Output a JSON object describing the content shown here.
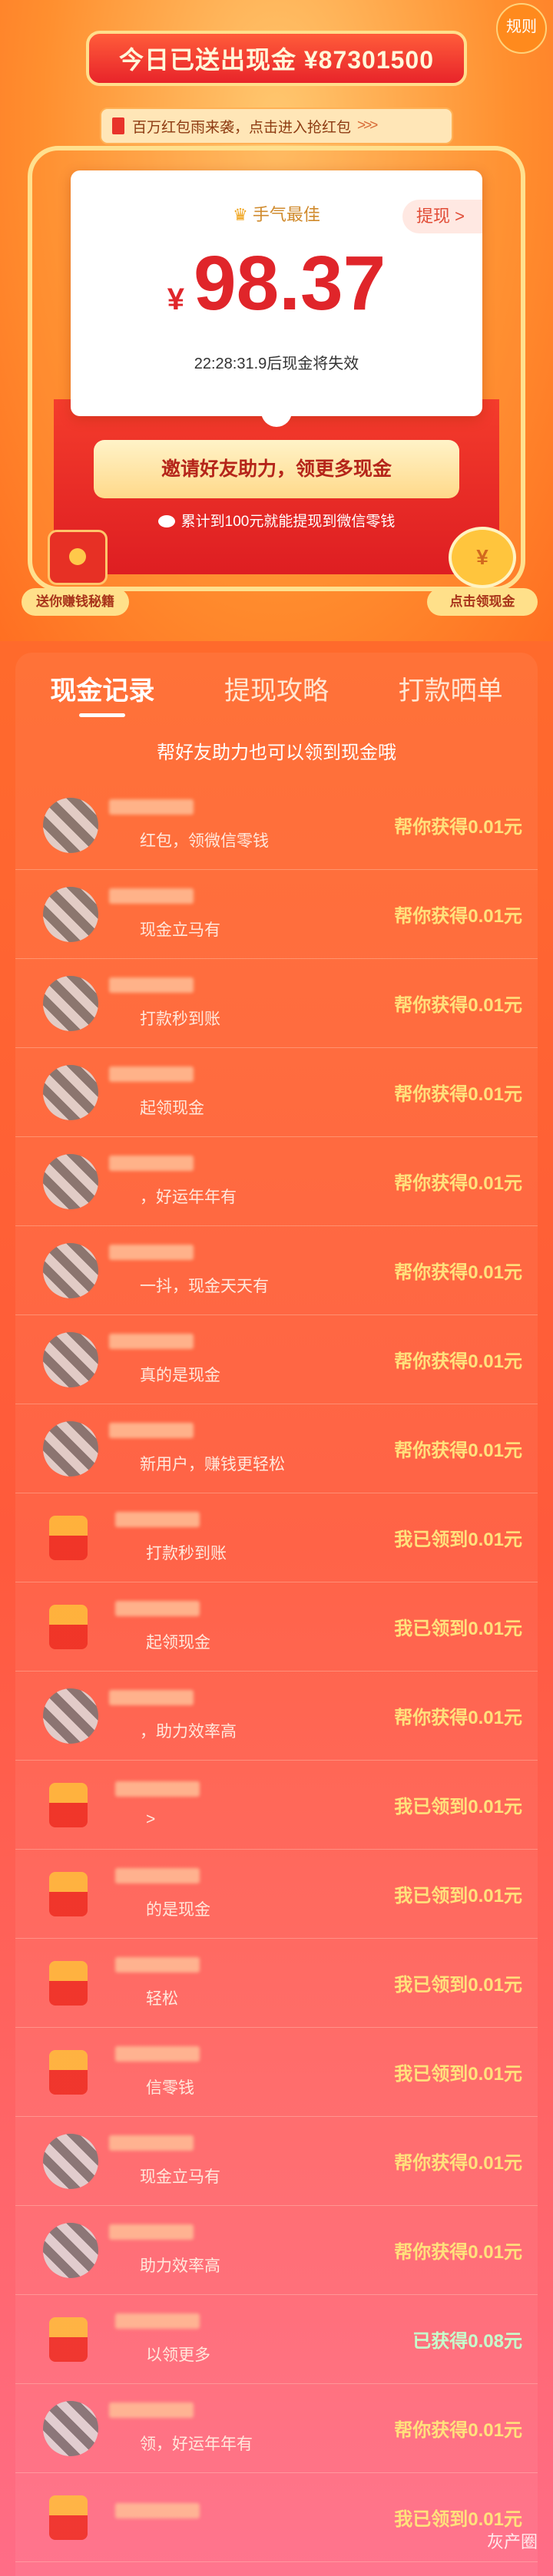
{
  "header": {
    "rules_label": "规则",
    "banner_text": "今日已送出现金 ¥87301500",
    "notice_text": "百万红包雨来袭，点击进入抢红包",
    "notice_arrows": ">>>"
  },
  "card": {
    "best_label": "手气最佳",
    "withdraw_label": "提现 >",
    "currency": "¥",
    "amount": "98.37",
    "expire_text": "22:28:31.9后现金将失效"
  },
  "actions": {
    "invite_label": "邀请好友助力，领更多现金",
    "hint_text": "累计到100元就能提现到微信零钱",
    "secret_label": "送你赚钱秘籍",
    "claim_label": "点击领现金",
    "clock_symbol": "¥"
  },
  "tabs": [
    {
      "label": "现金记录"
    },
    {
      "label": "提现攻略"
    },
    {
      "label": "打款晒单"
    }
  ],
  "subtitle": "帮好友助力也可以领到现金哦",
  "records": [
    {
      "msg": "红包，领微信零钱",
      "result": "帮你获得0.01元"
    },
    {
      "msg": "现金立马有",
      "result": "帮你获得0.01元"
    },
    {
      "msg": "打款秒到账",
      "result": "帮你获得0.01元"
    },
    {
      "msg": "起领现金",
      "result": "帮你获得0.01元"
    },
    {
      "msg": "，好运年年有",
      "result": "帮你获得0.01元"
    },
    {
      "msg": "一抖，现金天天有",
      "result": "帮你获得0.01元"
    },
    {
      "msg": "真的是现金",
      "result": "帮你获得0.01元"
    },
    {
      "msg": "新用户，赚钱更轻松",
      "result": "帮你获得0.01元"
    },
    {
      "msg": "打款秒到账",
      "result": "我已领到0.01元"
    },
    {
      "msg": "起领现金",
      "result": "我已领到0.01元"
    },
    {
      "msg": "，助力效率高",
      "result": "帮你获得0.01元"
    },
    {
      "msg": ">",
      "result": "我已领到0.01元"
    },
    {
      "msg": "的是现金",
      "result": "我已领到0.01元"
    },
    {
      "msg": "轻松",
      "result": "我已领到0.01元"
    },
    {
      "msg": "信零钱",
      "result": "我已领到0.01元"
    },
    {
      "msg": "现金立马有",
      "result": "帮你获得0.01元"
    },
    {
      "msg": "助力效率高",
      "result": "帮你获得0.01元"
    },
    {
      "msg": "以领更多",
      "result": "已获得0.08元"
    },
    {
      "msg": "领，好运年年有",
      "result": "帮你获得0.01元"
    },
    {
      "msg": "",
      "result": "我已领到0.01元"
    }
  ],
  "watermark": "灰产圈",
  "colors": {
    "accent": "#e0252a",
    "gold": "#ffe17c"
  }
}
